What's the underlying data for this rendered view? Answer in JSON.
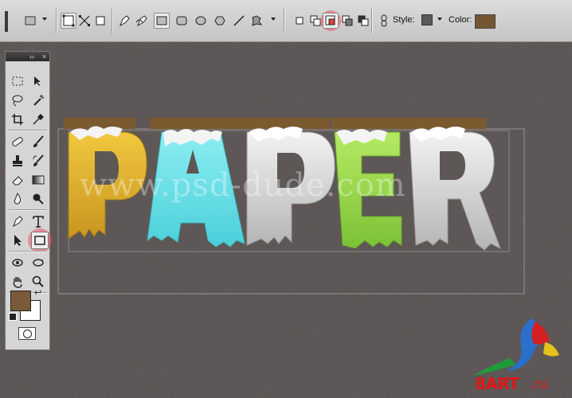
{
  "options_bar": {
    "style_label": "Style:",
    "color_label": "Color:",
    "swatch_color": "#755634"
  },
  "tools": {
    "foreground_color": "#7a5a38",
    "background_color": "#ffffff"
  },
  "canvas": {
    "headline": "PAPER",
    "letters": [
      "P",
      "A",
      "P",
      "E",
      "R"
    ],
    "letter_colors": [
      "#e4b634",
      "#6fdde6",
      "#cfcfcf",
      "#9ad64a",
      "#d4d4d4"
    ],
    "strip_color": "#7b5a30",
    "watermark": "www.psd-dude.com"
  },
  "logo": {
    "text": "8ART",
    "suffix": ".ru"
  }
}
